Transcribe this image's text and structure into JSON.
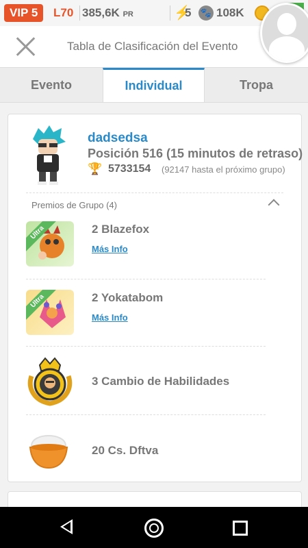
{
  "statusbar": {
    "vip": "VIP 5",
    "level": "L70",
    "power": "385,6K",
    "power_unit": "PR",
    "energy": "5",
    "paws": "108K",
    "accent": "#e8542a"
  },
  "header": {
    "title": "Tabla de Clasificación del Evento"
  },
  "tabs": [
    {
      "label": "Evento"
    },
    {
      "label": "Individual"
    },
    {
      "label": "Tropa"
    }
  ],
  "profile": {
    "username": "dadsedsa",
    "position": "Posición 516 (15 minutos de retraso)",
    "score": "5733154",
    "next_group": "(92147 hasta el próximo grupo)"
  },
  "rewards": {
    "header": "Premios de Grupo (4)",
    "badge": "Ultra",
    "more_info": "Más Info",
    "items": [
      {
        "name": "2 Blazefox"
      },
      {
        "name": "2 Yokatabom"
      },
      {
        "name": "3 Cambio de Habilidades"
      },
      {
        "name": "20 Cs. Dftva"
      }
    ]
  },
  "colors": {
    "link": "#2a8ac9",
    "active_tab": "#2a8ac9",
    "ultra_badge": "#5cb85c"
  }
}
